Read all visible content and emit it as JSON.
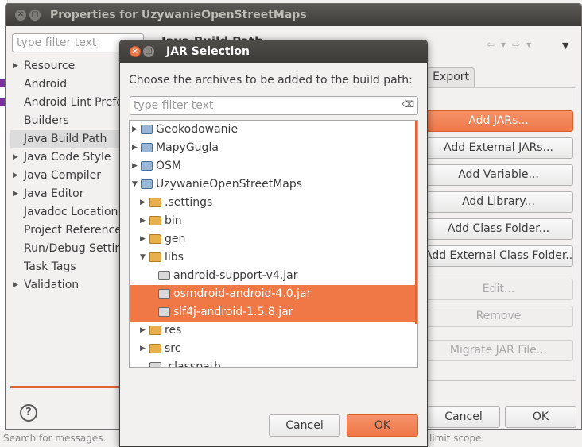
{
  "background": {
    "bottom_left_text": "Search for messages.",
    "bottom_right_text": "limit scope."
  },
  "properties": {
    "title": "Properties for UzywanieOpenStreetMaps",
    "filter_placeholder": "type filter text",
    "nav_items": [
      {
        "label": "Resource",
        "expandable": true
      },
      {
        "label": "Android",
        "expandable": false
      },
      {
        "label": "Android Lint Preferences",
        "expandable": false
      },
      {
        "label": "Builders",
        "expandable": false
      },
      {
        "label": "Java Build Path",
        "expandable": false,
        "selected": true
      },
      {
        "label": "Java Code Style",
        "expandable": true
      },
      {
        "label": "Java Compiler",
        "expandable": true
      },
      {
        "label": "Java Editor",
        "expandable": true
      },
      {
        "label": "Javadoc Location",
        "expandable": false
      },
      {
        "label": "Project References",
        "expandable": false
      },
      {
        "label": "Run/Debug Settings",
        "expandable": false
      },
      {
        "label": "Task Tags",
        "expandable": false
      },
      {
        "label": "Validation",
        "expandable": true
      }
    ],
    "section_title": "Java Build Path",
    "tab_export": "Export",
    "buttons": {
      "add_jars": "Add JARs...",
      "add_external_jars": "Add External JARs...",
      "add_variable": "Add Variable...",
      "add_library": "Add Library...",
      "add_class_folder": "Add Class Folder...",
      "add_external_class_folder": "Add External Class Folder...",
      "edit": "Edit...",
      "remove": "Remove",
      "migrate_jar": "Migrate JAR File...",
      "cancel": "Cancel",
      "ok": "OK",
      "help": "?"
    }
  },
  "jar_dialog": {
    "title": "JAR Selection",
    "prompt": "Choose the archives to be added to the build path:",
    "filter_placeholder": "type filter text",
    "tree": [
      {
        "label": "Geokodowanie"
      },
      {
        "label": "MapyGugla"
      },
      {
        "label": "OSM"
      },
      {
        "label": "UzywanieOpenStreetMaps"
      },
      {
        "label": ".settings"
      },
      {
        "label": "bin"
      },
      {
        "label": "gen"
      },
      {
        "label": "libs"
      },
      {
        "label": "android-support-v4.jar"
      },
      {
        "label": "osmdroid-android-4.0.jar"
      },
      {
        "label": "slf4j-android-1.5.8.jar"
      },
      {
        "label": "res"
      },
      {
        "label": "src"
      },
      {
        "label": ".classpath"
      }
    ],
    "cancel": "Cancel",
    "ok": "OK"
  }
}
